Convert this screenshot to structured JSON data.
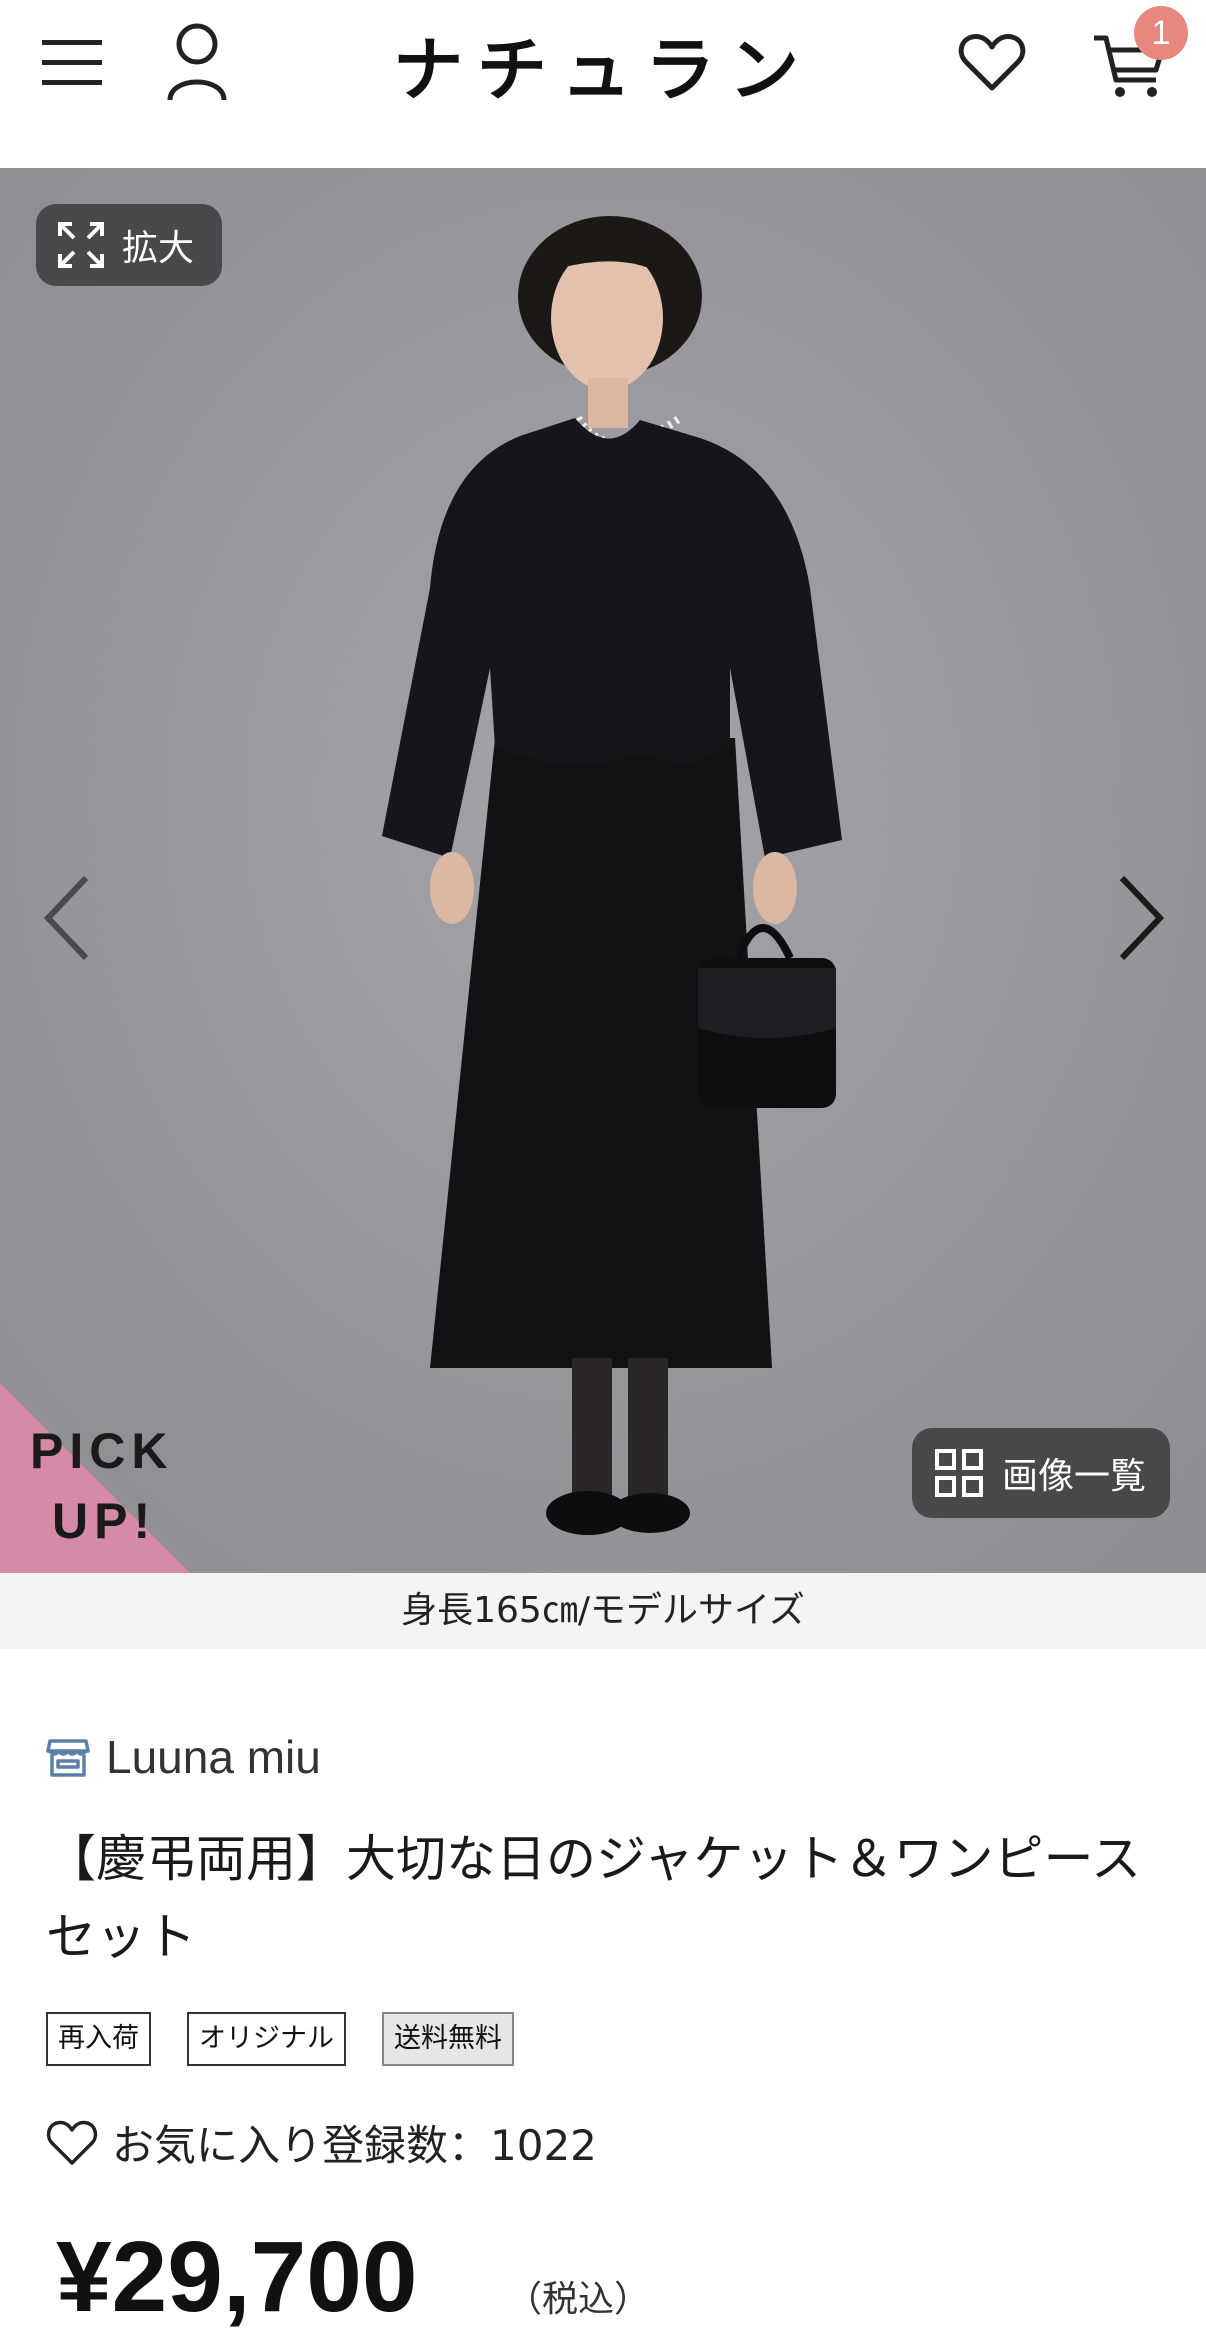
{
  "header": {
    "logo": "ナチュラン",
    "cart_count": "1",
    "icons": [
      "menu-icon",
      "account-icon",
      "heart-icon",
      "cart-icon"
    ]
  },
  "hero": {
    "zoom_label": "拡大",
    "pickup_line1": "PICK",
    "pickup_line2": "UP!",
    "gallery_label": "画像一覧",
    "caption": "身長165㎝/モデルサイズ",
    "background_color": "#9a9a9f"
  },
  "product": {
    "shop_name": "Luuna miu",
    "title": "【慶弔両用】大切な日のジャケット＆ワンピースセット",
    "tags": [
      "再入荷",
      "オリジナル",
      "送料無料"
    ],
    "favorite_count_label": "お気に入り登録数：1022",
    "price": "¥29,700",
    "tax_note": "（税込）"
  },
  "colors": {
    "badge": "#e8877e",
    "pickup_corner": "#d48aa8"
  }
}
